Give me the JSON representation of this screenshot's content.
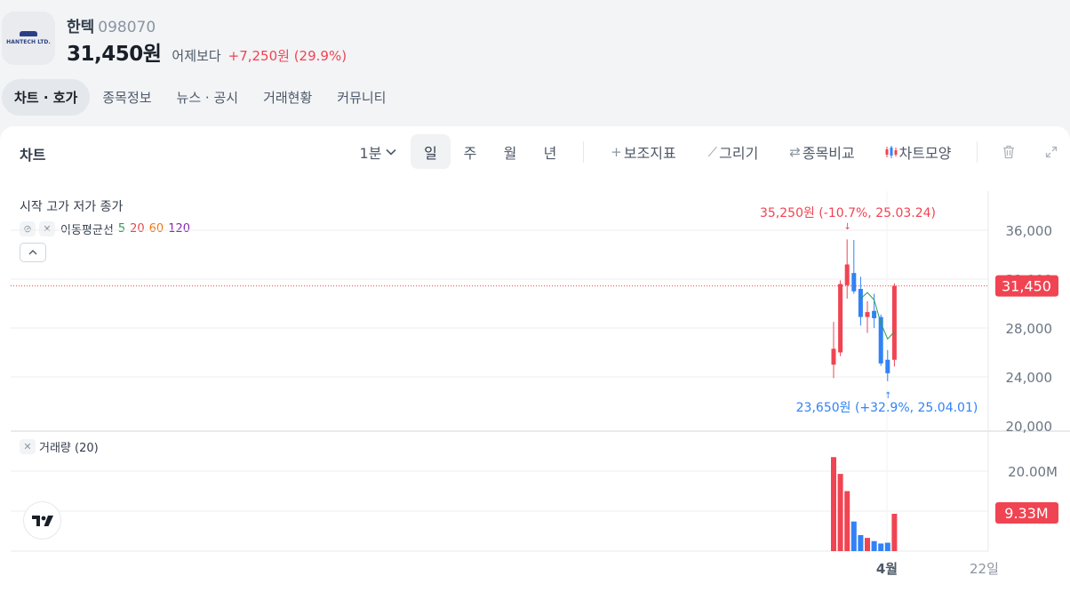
{
  "stock": {
    "name": "한텍",
    "code": "098070",
    "price": "31,450원",
    "compare_label": "어제보다",
    "change": "+7,250원 (29.9%)",
    "logo_text": "HANTECH LTD."
  },
  "tabs": [
    "차트 · 호가",
    "종목정보",
    "뉴스 · 공시",
    "거래현황",
    "커뮤니티"
  ],
  "toolbar": {
    "title": "차트",
    "interval": "1분",
    "periods": [
      "일",
      "주",
      "월",
      "년"
    ],
    "indicators": "보조지표",
    "draw": "그리기",
    "compare": "종목비교",
    "chart_shape": "차트모양"
  },
  "legend": {
    "ohlc": "시작 고가 저가 종가",
    "ma_label": "이동평균선",
    "ma_periods": [
      "5",
      "20",
      "60",
      "120"
    ],
    "volume_label": "거래량 (20)"
  },
  "colors": {
    "up": "#f04452",
    "down": "#3182f6",
    "ma5": "#2e9d54",
    "ma20": "#e8484a",
    "ma60": "#f0780f",
    "ma120": "#8a2bb0"
  },
  "chart_data": {
    "type": "candlestick",
    "price_axis": {
      "ticks": [
        "36,000",
        "32,000",
        "28,000",
        "24,000",
        "20,000"
      ],
      "ylim": [
        20000,
        38000
      ]
    },
    "volume_axis": {
      "ticks": [
        "20.00M"
      ],
      "ylim": [
        0,
        25000000
      ]
    },
    "x_labels": [
      "4월",
      "22일"
    ],
    "current_price_label": "31,450",
    "current_volume_label": "9.33M",
    "high_annotation": "35,250원 (-10.7%, 25.03.24)",
    "low_annotation": "23,650원 (+32.9%, 25.04.01)",
    "candles": [
      {
        "o": 25000,
        "h": 28500,
        "l": 23900,
        "c": 26300,
        "v": 23500000
      },
      {
        "o": 26000,
        "h": 31900,
        "l": 25700,
        "c": 31600,
        "v": 19300000
      },
      {
        "o": 31500,
        "h": 35250,
        "l": 30400,
        "c": 33200,
        "v": 15000000
      },
      {
        "o": 32500,
        "h": 35200,
        "l": 30800,
        "c": 31000,
        "v": 7400000
      },
      {
        "o": 31200,
        "h": 32200,
        "l": 28200,
        "c": 28900,
        "v": 4000000
      },
      {
        "o": 28900,
        "h": 30200,
        "l": 27600,
        "c": 29300,
        "v": 3300000
      },
      {
        "o": 29400,
        "h": 30800,
        "l": 28000,
        "c": 28800,
        "v": 2500000
      },
      {
        "o": 28900,
        "h": 29100,
        "l": 24900,
        "c": 25100,
        "v": 1900000
      },
      {
        "o": 25400,
        "h": 26200,
        "l": 23650,
        "c": 24300,
        "v": 2100000
      },
      {
        "o": 25400,
        "h": 31650,
        "l": 24850,
        "c": 31450,
        "v": 9330000
      }
    ],
    "ma5": [
      null,
      null,
      null,
      null,
      30400,
      30900,
      30300,
      28400,
      27100,
      27700
    ]
  }
}
